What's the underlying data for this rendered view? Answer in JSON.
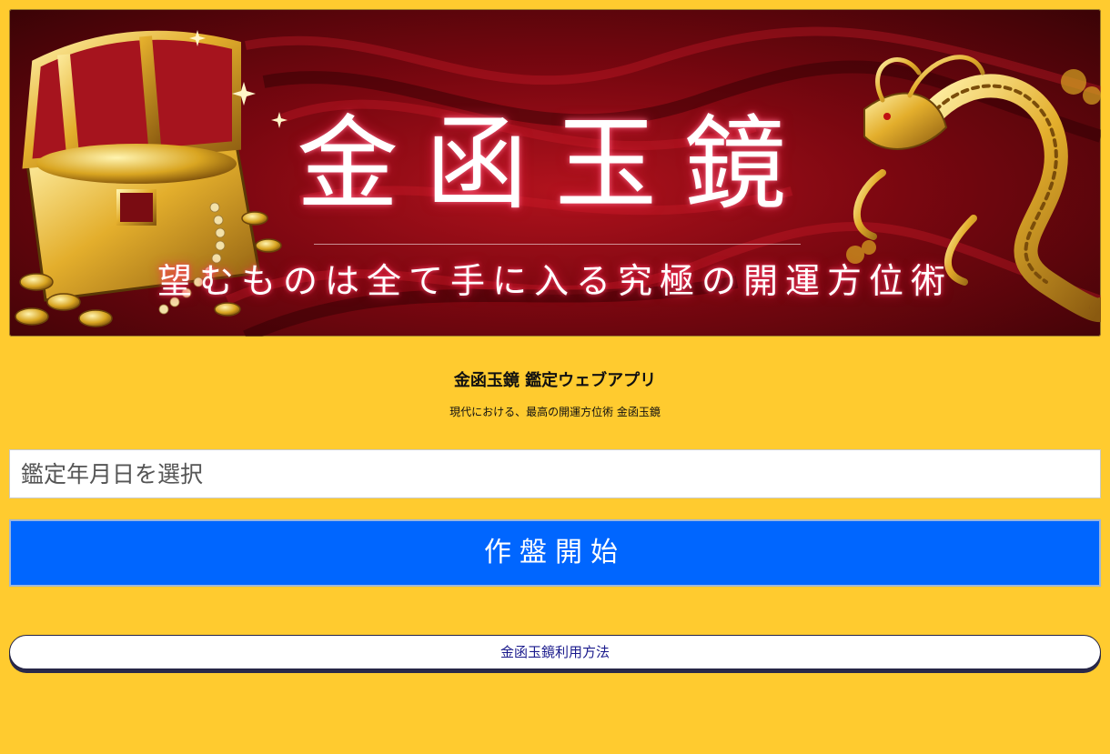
{
  "banner": {
    "title": "金函玉鏡",
    "tagline": "望むものは全て手に入る究極の開運方位術"
  },
  "app": {
    "title": "金函玉鏡 鑑定ウェブアプリ",
    "subtitle": "現代における、最高の開運方位術 金函玉鏡"
  },
  "form": {
    "date_placeholder": "鑑定年月日を選択",
    "start_label": "作盤開始",
    "usage_label": "金函玉鏡利用方法"
  },
  "colors": {
    "page_bg": "#FFCB2F",
    "start_button": "#0066FF",
    "banner_red": "#9E0E18",
    "gold": "#D9A521"
  },
  "icons": [
    "treasure-chest-icon",
    "dragon-icon"
  ]
}
